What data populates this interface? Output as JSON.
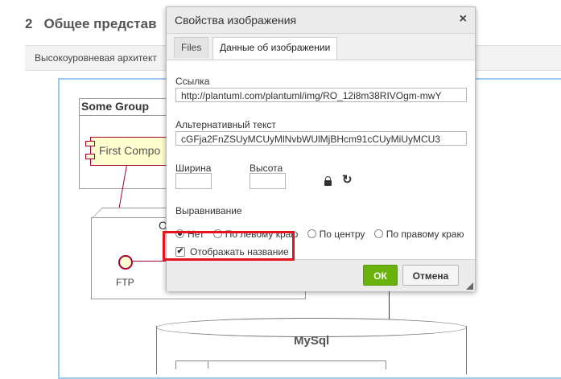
{
  "document": {
    "section_number": "2",
    "section_title": "Общее представ",
    "bar_text": "Высокоуровневая архитект"
  },
  "diagram": {
    "package_title": "Some Group",
    "component_label": "First Compo",
    "node_label": "O",
    "interface_label": "FTP",
    "database_label": "MySql"
  },
  "dialog": {
    "title": "Свойства изображения",
    "close_symbol": "×",
    "tabs": [
      {
        "label": "Files"
      },
      {
        "label": "Данные об изображении",
        "active": true
      }
    ],
    "url_label": "Ссылка",
    "url_value": "http://plantuml.com/plantuml/img/RO_12i8m38RIVOgm-mwY",
    "alt_label": "Альтернативный текст",
    "alt_value": "cGFja2FnZSUyMCUyMlNvbWUlMjBHcm91cCUyMiUyMCU3",
    "width_label": "Ширина",
    "width_value": "",
    "height_label": "Высота",
    "height_value": "",
    "lock_icon": "lock-icon",
    "reset_icon": "refresh-icon",
    "reset_symbol": "↻",
    "alignment_label": "Выравнивание",
    "alignment_options": [
      {
        "label": "Нет",
        "checked": true
      },
      {
        "label": "По левому краю",
        "checked": false
      },
      {
        "label": "По центру",
        "checked": false
      },
      {
        "label": "По правому краю",
        "checked": false
      }
    ],
    "caption_label": "Отображать название",
    "caption_checked": true,
    "check_symbol": "✔",
    "ok_label": "ОК",
    "cancel_label": "Отмена"
  },
  "colors": {
    "ok_button": "#69b10b",
    "highlight": "#e4141e",
    "diagram_frame": "#9ccaf0"
  }
}
